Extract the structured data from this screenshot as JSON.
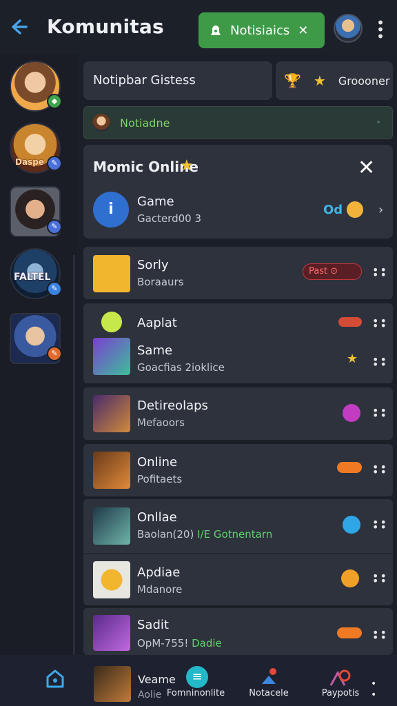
{
  "header": {
    "title": "Komunitas",
    "notifications_label": "Notisiaics",
    "more_icon": "kebab-icon"
  },
  "rail": {
    "items": [
      {
        "name": "avatar-1",
        "badge_color": "#3fa34d"
      },
      {
        "name": "avatar-2",
        "tag": "Daspe",
        "badge_color": "#4a70d8"
      },
      {
        "name": "avatar-3",
        "badge_color": "#4a70d8"
      },
      {
        "name": "avatar-4",
        "tag": "FALTEL",
        "badge_color": "#3b82e0"
      },
      {
        "name": "avatar-5",
        "badge_color": "#e06b2f"
      }
    ]
  },
  "search": {
    "placeholder": "Notipbar Gistess"
  },
  "filter": {
    "label": "Groooner"
  },
  "notice": {
    "text": "Notiadne"
  },
  "online": {
    "title": "Momic Online",
    "game": {
      "name": "Game",
      "subtitle": "Gacterd00 3",
      "status": "Od"
    }
  },
  "rows": [
    {
      "name": "Sorly",
      "sub": "Boraaurs",
      "badge": "Past"
    },
    {
      "name": "Aaplat",
      "sub": ""
    },
    {
      "name": "Same",
      "sub": "Goacfias 2ioklice"
    },
    {
      "name": "Detireolaps",
      "sub": "Mefaoors"
    },
    {
      "name": "Online",
      "sub": "Pofitaets"
    },
    {
      "name": "Onllae",
      "sub": "Baolan(20)",
      "sub_highlight": "I/E Gotnentarn"
    },
    {
      "name": "Apdiae",
      "sub": "Mdanore"
    },
    {
      "name": "Sadit",
      "sub": "OpM-755!",
      "sub_highlight": "Dadie"
    }
  ],
  "bottom_nav": {
    "items": [
      {
        "label": ""
      },
      {
        "label": "Veame",
        "sub": "Aolie"
      },
      {
        "label": "Fomninonlite"
      },
      {
        "label": "Notacele"
      },
      {
        "label": "Paypotis"
      }
    ]
  },
  "colors": {
    "background": "#1b1f27",
    "card": "#2e323d",
    "accent_green": "#3f9a48",
    "accent_blue": "#4aa3e6",
    "highlight_green": "#7fd36b"
  }
}
